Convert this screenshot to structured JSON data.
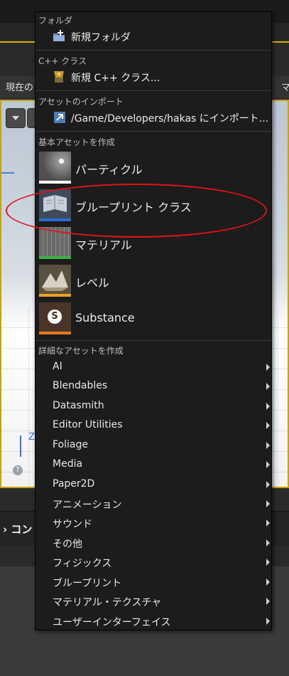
{
  "background": {
    "breadcrumb_prefix": "現在の",
    "breadcrumb_right": "マ",
    "bottom_bar_label": "› コン",
    "viewport_axis": "Z",
    "viewport_help": "?"
  },
  "menu": {
    "folder_section": {
      "header": "フォルダ",
      "item_label": "新規フォルダ",
      "icon": "new-folder-icon"
    },
    "cpp_section": {
      "header": "C++ クラス",
      "item_label": "新規 C++ クラス...",
      "icon": "cpp-class-icon"
    },
    "import_section": {
      "header": "アセットのインポート",
      "item_label": "/Game/Developers/hakas にインポート...",
      "icon": "import-icon"
    },
    "basic_section": {
      "header": "基本アセットを作成",
      "items": [
        {
          "label": "パーティクル",
          "icon": "particle-icon",
          "color": "#ffffff"
        },
        {
          "label": "ブループリント クラス",
          "icon": "blueprint-icon",
          "color": "#2d6bd6"
        },
        {
          "label": "マテリアル",
          "icon": "material-icon",
          "color": "#3cb043"
        },
        {
          "label": "レベル",
          "icon": "level-icon",
          "color": "#f0a020"
        },
        {
          "label": "Substance",
          "icon": "substance-icon",
          "color": "#e67a1e"
        }
      ]
    },
    "advanced_section": {
      "header": "詳細なアセットを作成",
      "items": [
        "AI",
        "Blendables",
        "Datasmith",
        "Editor Utilities",
        "Foliage",
        "Media",
        "Paper2D",
        "アニメーション",
        "サウンド",
        "その他",
        "フィジックス",
        "ブループリント",
        "マテリアル・テクスチャ",
        "ユーザーインターフェイス"
      ]
    }
  },
  "annotation_color": "#e0121b"
}
